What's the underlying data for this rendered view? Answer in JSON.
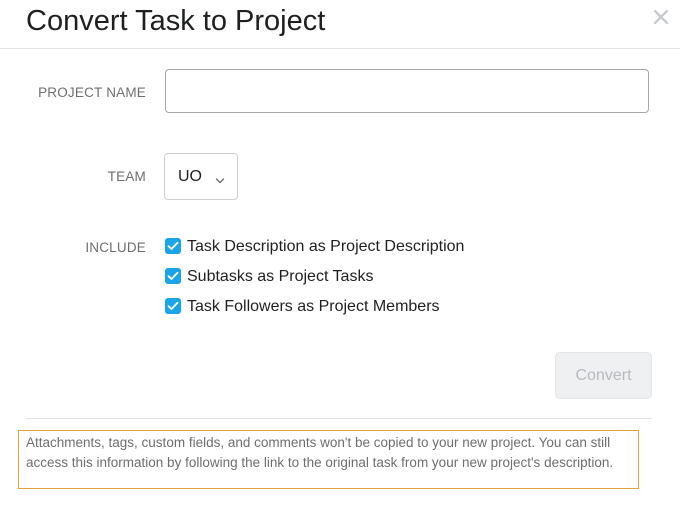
{
  "dialog": {
    "title": "Convert Task to Project",
    "close_icon": "close-icon"
  },
  "form": {
    "project_name": {
      "label": "PROJECT NAME",
      "value": "",
      "placeholder": ""
    },
    "team": {
      "label": "TEAM",
      "selected": "UO",
      "dropdown_icon": "chevron-down-icon"
    },
    "include": {
      "label": "INCLUDE",
      "options": [
        {
          "label": "Task Description as Project Description",
          "checked": true
        },
        {
          "label": "Subtasks as Project Tasks",
          "checked": true
        },
        {
          "label": "Task Followers as Project Members",
          "checked": true
        }
      ]
    }
  },
  "actions": {
    "convert_label": "Convert",
    "convert_enabled": false
  },
  "notice": {
    "text": "Attachments, tags, custom fields, and comments won't be copied to your new project. You can still access this information by following the link to the original task from your new project's description.",
    "highlight_color": "#e8a13a"
  },
  "colors": {
    "checkbox": "#1aa5e9",
    "text": "#1e1f21",
    "muted": "#6d6e6f"
  }
}
